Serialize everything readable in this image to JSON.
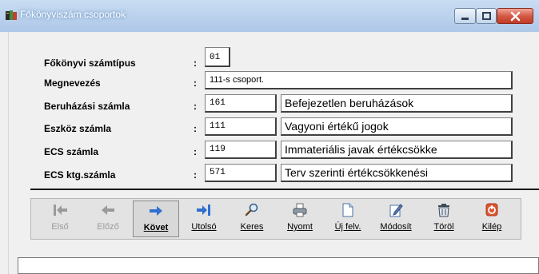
{
  "window": {
    "title": "Főkönyviszám csoportok"
  },
  "fields": [
    {
      "label": "Főkönyvi számtípus",
      "colon": ":",
      "code": "01"
    },
    {
      "label": "Megnevezés",
      "colon": ":",
      "value": "111-s csoport."
    },
    {
      "label": "Beruházási számla",
      "colon": ":",
      "code": "161",
      "description": "Befejezetlen beruházások"
    },
    {
      "label": "Eszköz számla",
      "colon": ":",
      "code": "111",
      "description": "Vagyoni értékű jogok"
    },
    {
      "label": "ECS számla",
      "colon": ":",
      "code": "119",
      "description": "Immateriális javak értékcsökke"
    },
    {
      "label": "ECS ktg.számla",
      "colon": ":",
      "code": "571",
      "description": "Terv szerinti értékcsökkenési"
    }
  ],
  "toolbar": [
    {
      "label": "Első",
      "icon": "first-record-icon",
      "enabled": false
    },
    {
      "label": "Előző",
      "icon": "previous-record-icon",
      "enabled": false
    },
    {
      "label": "Követ",
      "icon": "next-record-icon",
      "enabled": true,
      "active": true
    },
    {
      "label": "Utolsó",
      "icon": "last-record-icon",
      "enabled": true
    },
    {
      "label": "Keres",
      "icon": "search-icon",
      "enabled": true
    },
    {
      "label": "Nyomt",
      "icon": "printer-icon",
      "enabled": true
    },
    {
      "label": "Új felv.",
      "icon": "new-document-icon",
      "enabled": true
    },
    {
      "label": "Módosít",
      "icon": "edit-icon",
      "enabled": true
    },
    {
      "label": "Töröl",
      "icon": "delete-icon",
      "enabled": true
    },
    {
      "label": "Kilép",
      "icon": "exit-icon",
      "enabled": true
    }
  ],
  "status": {
    "text": ""
  },
  "colors": {
    "arrow_enabled": "#2f6fd0",
    "arrow_disabled": "#9a9a9a",
    "exit": "#e0532f"
  }
}
